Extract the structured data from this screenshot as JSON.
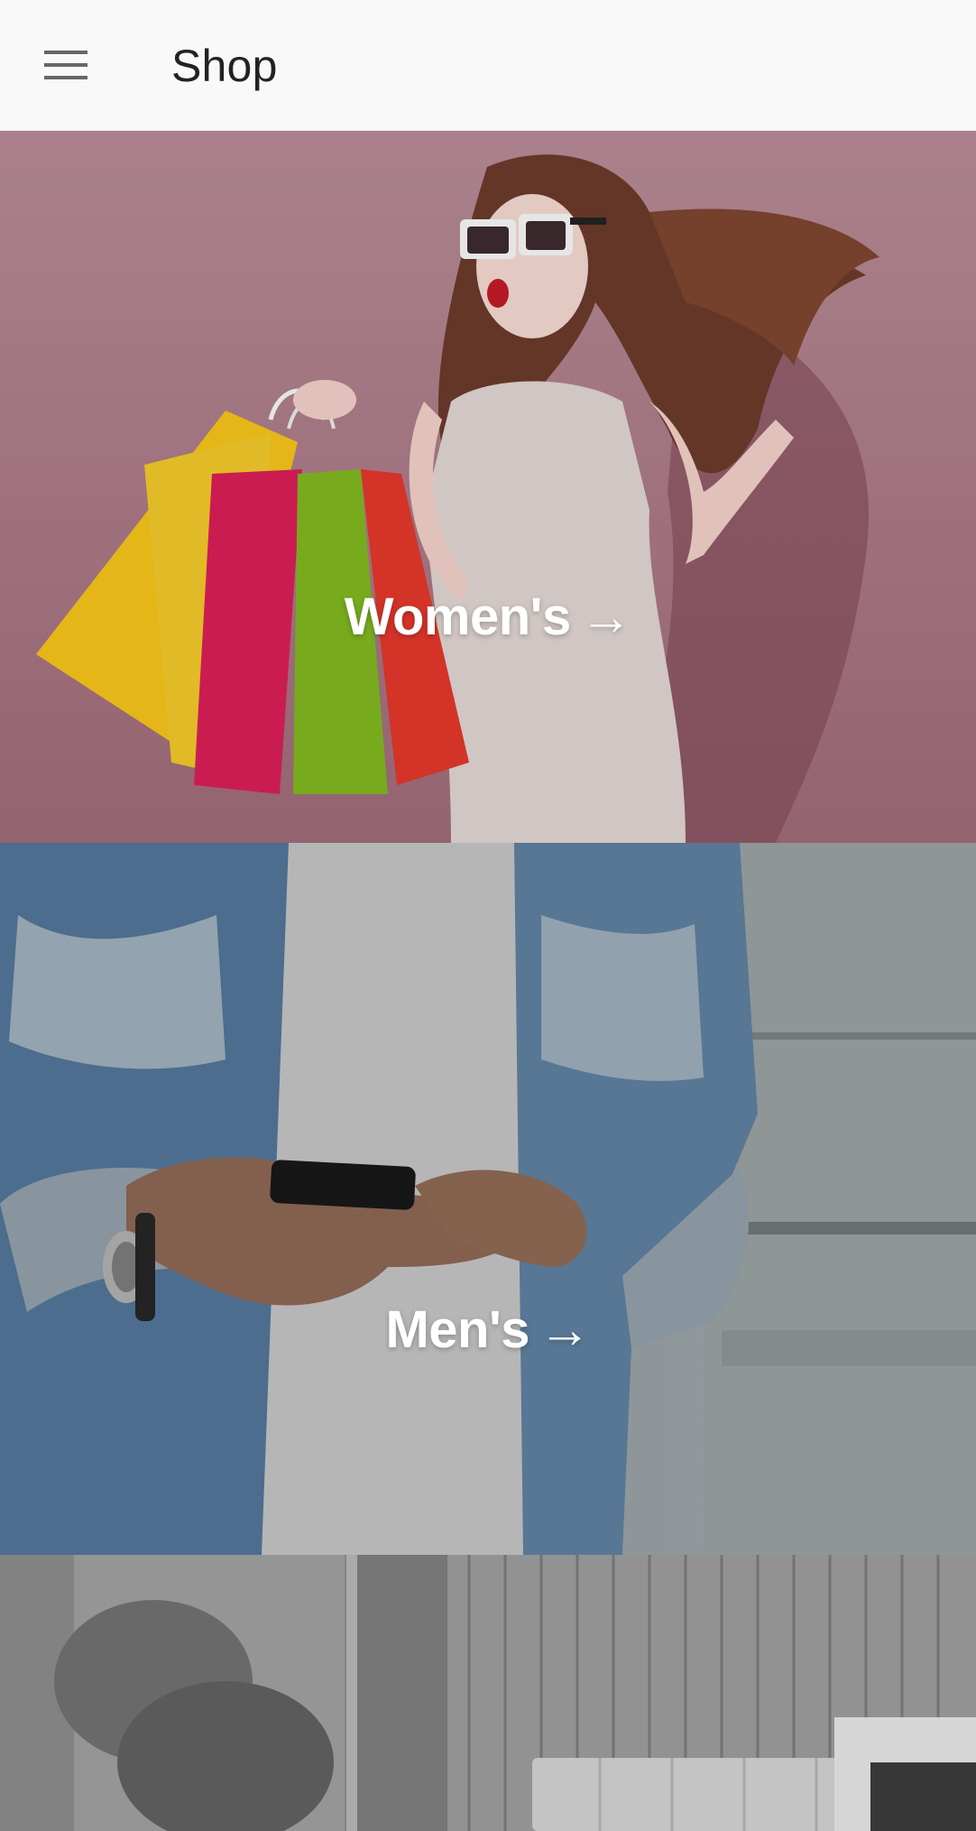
{
  "app_bar": {
    "menu_icon": "hamburger-menu-icon",
    "title": "Shop"
  },
  "categories": [
    {
      "label": "Women's",
      "arrow": "→",
      "image": "woman-with-shopping-bags"
    },
    {
      "label": "Men's",
      "arrow": "→",
      "image": "man-in-denim-shirt-holding-phone"
    },
    {
      "label": "",
      "image": "bedroom-interior"
    }
  ],
  "colors": {
    "app_bar_bg": "#f9f9f9",
    "title": "#222222",
    "women_tile_bg": "#b07d89",
    "men_tile_bg": "#8e9aa3",
    "home_tile_bg": "#8a8a8a",
    "label": "#ffffff"
  }
}
